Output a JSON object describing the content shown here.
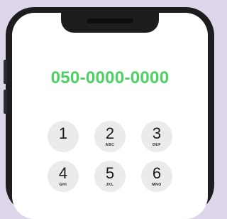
{
  "dialer": {
    "number": "050-0000-0000",
    "keys": [
      {
        "digit": "1",
        "letters": ""
      },
      {
        "digit": "2",
        "letters": "ABC"
      },
      {
        "digit": "3",
        "letters": "DEF"
      },
      {
        "digit": "4",
        "letters": "GHI"
      },
      {
        "digit": "5",
        "letters": "JKL"
      },
      {
        "digit": "6",
        "letters": "MNO"
      }
    ]
  },
  "colors": {
    "background": "#ded7ec",
    "phone_frame": "#1d1d1f",
    "number_text": "#4cd163",
    "key_fill": "#ebebeb"
  }
}
